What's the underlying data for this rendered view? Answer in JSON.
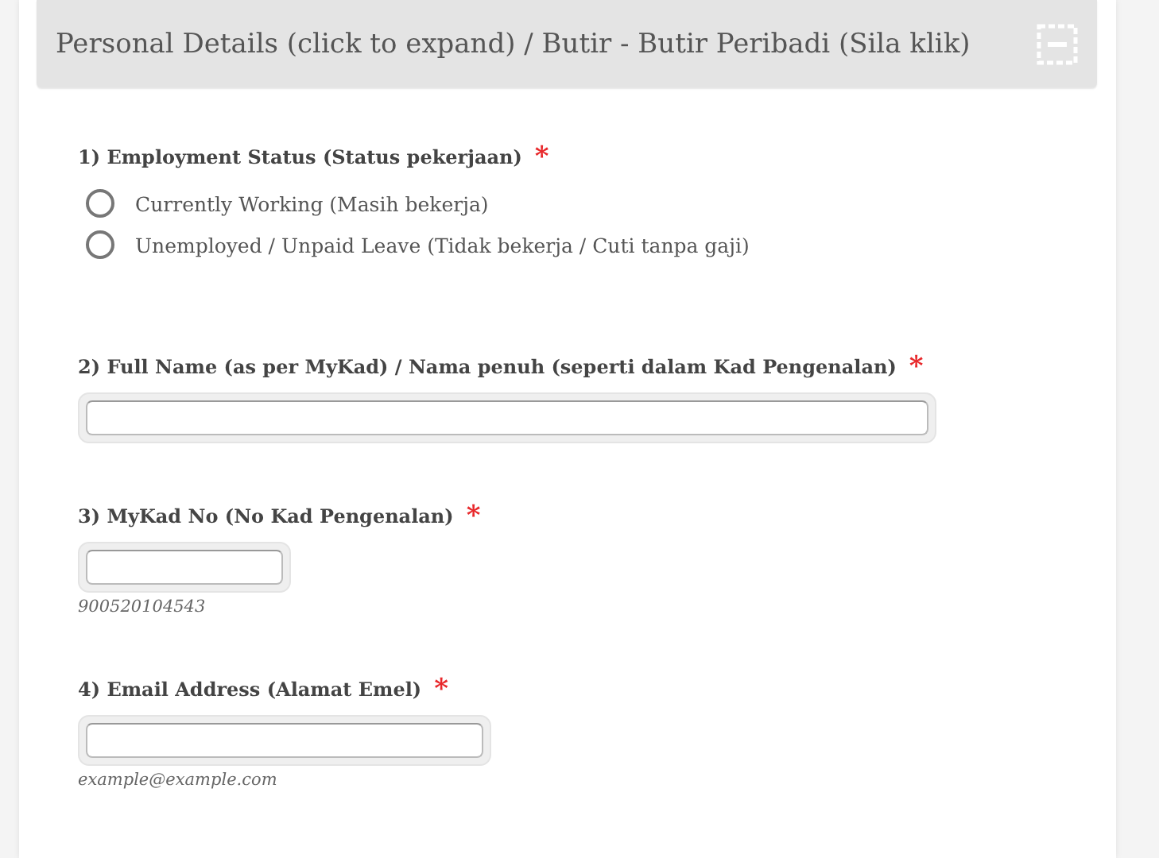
{
  "section": {
    "title": "Personal Details (click to expand) / Butir - Butir Peribadi (Sila klik)",
    "expanded": true
  },
  "questions": [
    {
      "kind": "radio",
      "label": "1) Employment Status (Status pekerjaan)",
      "required_mark": "*",
      "options": [
        {
          "label": "Currently Working (Masih bekerja)",
          "selected": false
        },
        {
          "label": "Unemployed / Unpaid Leave (Tidak bekerja / Cuti tanpa gaji)",
          "selected": false
        }
      ]
    },
    {
      "kind": "wide",
      "label": "2) Full Name (as per MyKad) / Nama penuh (seperti dalam Kad Pengenalan)",
      "required_mark": "*"
    },
    {
      "kind": "short",
      "label": "3) MyKad No (No Kad Pengenalan)",
      "required_mark": "*",
      "hint": "900520104543"
    },
    {
      "kind": "medium",
      "label": "4) Email Address (Alamat Emel)",
      "required_mark": "*",
      "hint": "example@example.com"
    }
  ]
}
